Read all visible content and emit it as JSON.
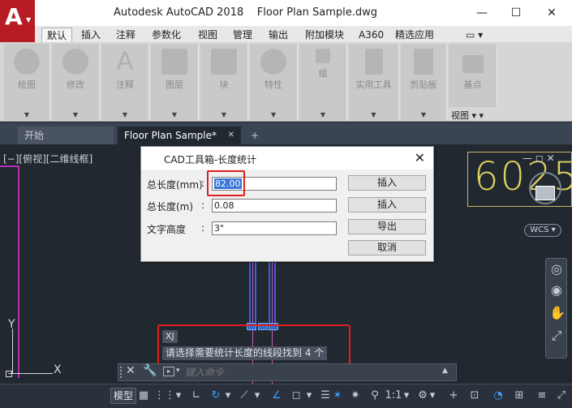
{
  "window": {
    "title": "Autodesk AutoCAD 2018    Floor Plan Sample.dwg",
    "minimize": "—",
    "maximize": "☐",
    "close": "✕"
  },
  "app_logo": "A",
  "ribbon_tabs": [
    "默认",
    "插入",
    "注释",
    "参数化",
    "视图",
    "管理",
    "输出",
    "附加模块",
    "A360",
    "精选应用"
  ],
  "ribbon_groups": [
    "绘图",
    "修改",
    "注释",
    "图层",
    "块",
    "特性",
    "组",
    "实用工具",
    "剪贴板",
    "基点"
  ],
  "ribbon_view_label": "视图 ▾ ▾",
  "doc_tabs": {
    "home": "开始",
    "file": "Floor Plan Sample*",
    "close": "✕",
    "add": "+"
  },
  "viewport_label": "[−][俯视][二维线框]",
  "gold_text": "6025",
  "wcs_label": "WCS ▾",
  "navcube_controls": "— ◻ ✕",
  "dialog": {
    "title": "CAD工具箱-长度统计",
    "close": "✕",
    "rows": [
      {
        "label": "总长度(mm)",
        "colon": ":",
        "value": "82.00",
        "button": "插入"
      },
      {
        "label": "总长度(m)",
        "colon": ":",
        "value": "0.08",
        "button": "插入"
      },
      {
        "label": "文字高度",
        "colon": ":",
        "value": "3\"",
        "button": "导出"
      }
    ],
    "cancel": "取消"
  },
  "command": {
    "history_cmd": "XJ",
    "history_msg": "请选择需要统计长度的线段找到 4 个",
    "placeholder": "键入命令",
    "close": "✕",
    "wrench": "🔧",
    "prompt_icon": "▸",
    "prompt_caret": "▾",
    "up_arrow": "▲"
  },
  "ucs": {
    "x": "X",
    "y": "Y"
  },
  "status": {
    "model": "模型",
    "scale": "1:1",
    "grid_icon": "▦",
    "snap_icon": "⋮⋮"
  },
  "colors": {
    "accent_red": "#e02020",
    "selection_blue": "#3a78d8",
    "canvas": "#212830"
  }
}
